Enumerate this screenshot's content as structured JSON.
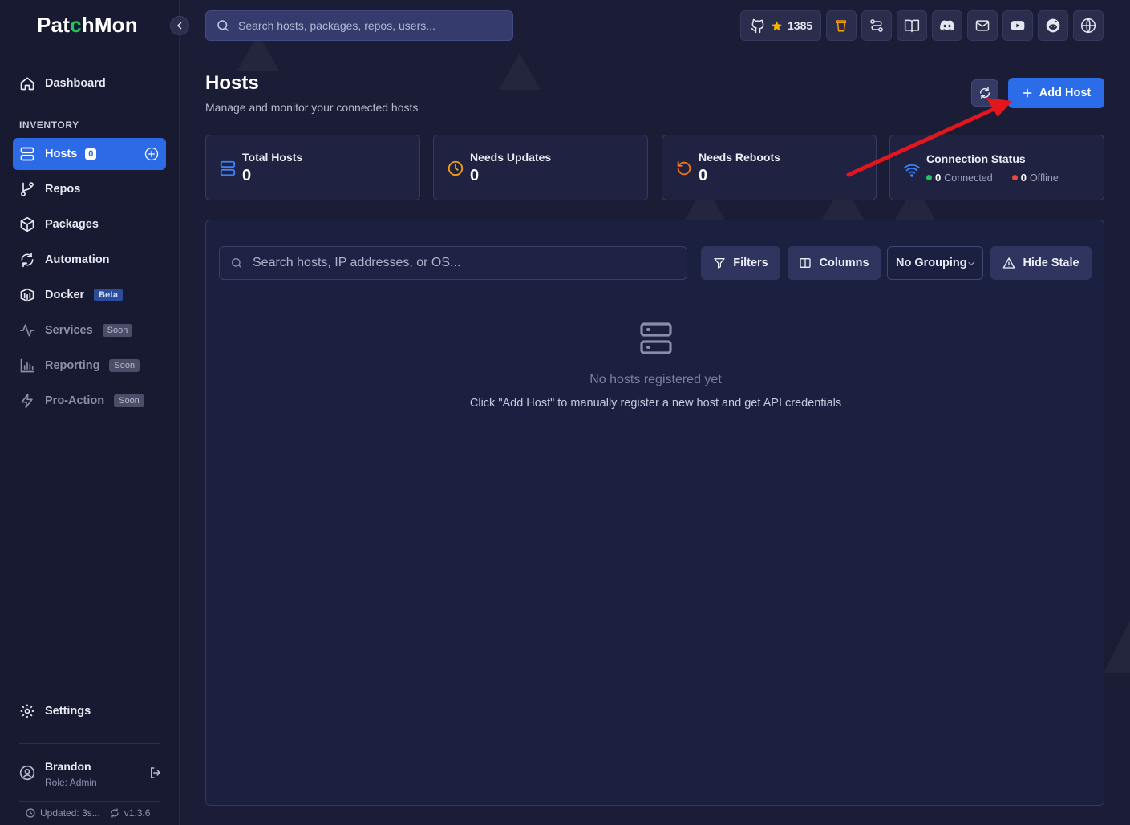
{
  "app": {
    "logo": "PatchMon",
    "collapse_icon": "chevron-left-icon"
  },
  "topbar": {
    "search_placeholder": "Search hosts, packages, repos, users...",
    "github_stars": "1385",
    "icons": [
      "github-icon",
      "star-icon",
      "coffee-icon",
      "roadmap-icon",
      "docs-icon",
      "discord-icon",
      "mail-icon",
      "youtube-icon",
      "reddit-icon",
      "globe-icon"
    ]
  },
  "sidebar": {
    "dashboard": "Dashboard",
    "section_inventory": "INVENTORY",
    "items": [
      {
        "label": "Hosts",
        "badge": "0",
        "active": true
      },
      {
        "label": "Repos"
      },
      {
        "label": "Packages"
      },
      {
        "label": "Automation"
      },
      {
        "label": "Docker",
        "badge": "Beta"
      },
      {
        "label": "Services",
        "badge": "Soon"
      },
      {
        "label": "Reporting",
        "badge": "Soon"
      },
      {
        "label": "Pro-Action",
        "badge": "Soon"
      }
    ],
    "settings": "Settings",
    "user": {
      "name": "Brandon",
      "role": "Role: Admin"
    },
    "updated": "Updated: 3s...",
    "version": "v1.3.6"
  },
  "page": {
    "title": "Hosts",
    "subtitle": "Manage and monitor your connected hosts",
    "add_host": "Add Host"
  },
  "stats": {
    "total_hosts": {
      "label": "Total Hosts",
      "value": "0"
    },
    "needs_updates": {
      "label": "Needs Updates",
      "value": "0"
    },
    "needs_reboots": {
      "label": "Needs Reboots",
      "value": "0"
    },
    "connection": {
      "label": "Connection Status",
      "connected_value": "0",
      "connected_label": "Connected",
      "offline_value": "0",
      "offline_label": "Offline"
    }
  },
  "table": {
    "search_placeholder": "Search hosts, IP addresses, or OS...",
    "filters": "Filters",
    "columns": "Columns",
    "grouping": "No Grouping",
    "hide_stale": "Hide Stale",
    "empty_title": "No hosts registered yet",
    "empty_sub": "Click \"Add Host\" to manually register a new host and get API credentials"
  },
  "colors": {
    "accent": "#2b6ce9",
    "connected": "#22c55e",
    "offline": "#ef4444",
    "warning": "#f59e0b",
    "annotation": "#e3161e"
  }
}
